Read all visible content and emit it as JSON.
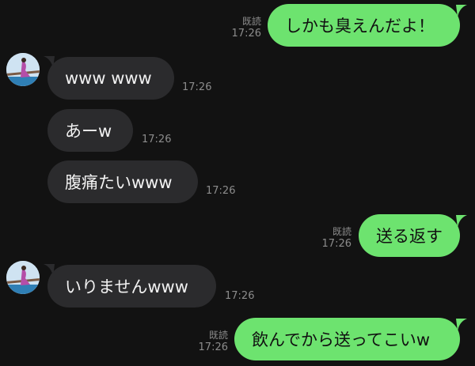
{
  "messages": [
    {
      "from": "me",
      "text": "しかも臭えんだよ！",
      "read": "既読",
      "time": "17:26"
    },
    {
      "from": "them",
      "text": "www www",
      "time": "17:26"
    },
    {
      "from": "them",
      "text": "あーw",
      "time": "17:26"
    },
    {
      "from": "them",
      "text": "腹痛たいwww",
      "time": "17:26"
    },
    {
      "from": "me",
      "text": "送る返す",
      "read": "既読",
      "time": "17:26"
    },
    {
      "from": "them",
      "text": "いりませんwww",
      "time": "17:26"
    },
    {
      "from": "me",
      "text": "飲んでから送ってこいw",
      "read": "既読",
      "time": "17:26"
    }
  ],
  "colors": {
    "background": "#121212",
    "outgoing_bubble": "#6de36f",
    "incoming_bubble": "#2b2b2d",
    "meta_text": "#8c8c8c"
  },
  "icons": [
    "contact-avatar"
  ]
}
